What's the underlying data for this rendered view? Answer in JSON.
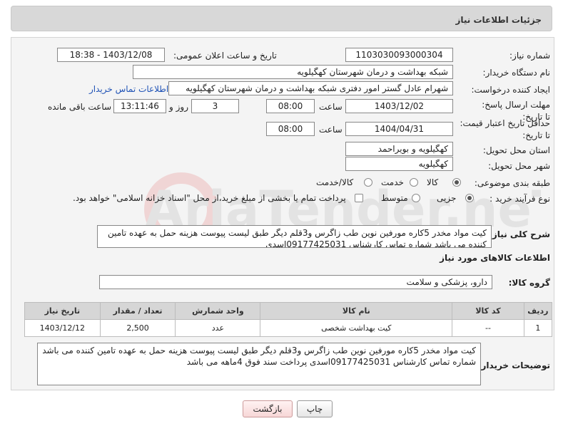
{
  "header": {
    "title": "جزئیات اطلاعات نیاز"
  },
  "form": {
    "need_number_label": "شماره نیاز:",
    "need_number": "1103030093000304",
    "announce_label": "تاریخ و ساعت اعلان عمومی:",
    "announce_value": "1403/12/08 - 18:38",
    "buyer_org_label": "نام دستگاه خریدار:",
    "buyer_org": "شبکه بهداشت و درمان شهرستان کهگیلویه",
    "requester_label": "ایجاد کننده درخواست:",
    "requester": "شهرام عادل گستر امور دفتری شبکه بهداشت و درمان شهرستان کهگیلویه",
    "contact_link": "اطلاعات تماس خریدار",
    "deadline_label": "مهلت ارسال پاسخ: تا تاریخ:",
    "deadline_date": "1403/12/02",
    "time_label": "ساعت",
    "deadline_time": "08:00",
    "days_value": "3",
    "days_label": "روز و",
    "remaining_value": "13:11:46",
    "remaining_label": "ساعت باقی مانده",
    "validity_label": "حداقل تاریخ اعتبار قیمت: تا تاریخ:",
    "validity_date": "1404/04/31",
    "validity_time": "08:00",
    "province_label": "استان محل تحویل:",
    "province": "کهگیلویه و بویراحمد",
    "city_label": "شهر محل تحویل:",
    "city": "کهگیلویه",
    "category_label": "طبقه بندی موضوعی:",
    "category_options": [
      "کالا",
      "خدمت",
      "کالا/خدمت"
    ],
    "category_selected": "کالا",
    "process_label": "نوع فرآیند خرید :",
    "process_options": [
      "جزیی",
      "متوسط"
    ],
    "process_selected": "جزیی",
    "payment_note": "پرداخت تمام یا بخشی از مبلغ خرید،از محل \"اسناد خزانه اسلامی\" خواهد بود.",
    "desc_label": "شرح کلی نیاز:",
    "description": "کیت مواد مخدر 5کاره مورفین نوین طب زاگرس و3قلم دیگر طبق لیست پیوست هزینه حمل به عهده تامین کننده می باشد شماره تماس کارشناس 09177425031اسدی",
    "goods_info_title": "اطلاعات کالاهای مورد نیاز",
    "goods_group_label": "گروه کالا:",
    "goods_group": "دارو، پزشکی و سلامت",
    "buyer_notes_label": "توضیحات خریدار:",
    "buyer_notes": "کیت مواد مخدر 5کاره مورفین نوین طب زاگرس و3قلم دیگر طبق لیست پیوست هزینه حمل به عهده تامین کننده می باشد شماره تماس کارشناس 09177425031اسدی پرداخت سند فوق 4ماهه می باشد"
  },
  "table": {
    "headers": [
      "ردیف",
      "کد کالا",
      "نام کالا",
      "واحد شمارش",
      "تعداد / مقدار",
      "تاریخ نیاز"
    ],
    "rows": [
      [
        "1",
        "--",
        "کیت بهداشت شخصی",
        "عدد",
        "2,500",
        "1403/12/12"
      ]
    ]
  },
  "buttons": {
    "print": "چاپ",
    "back": "بازگشت"
  },
  "watermark_text": "AriaTender.neT"
}
